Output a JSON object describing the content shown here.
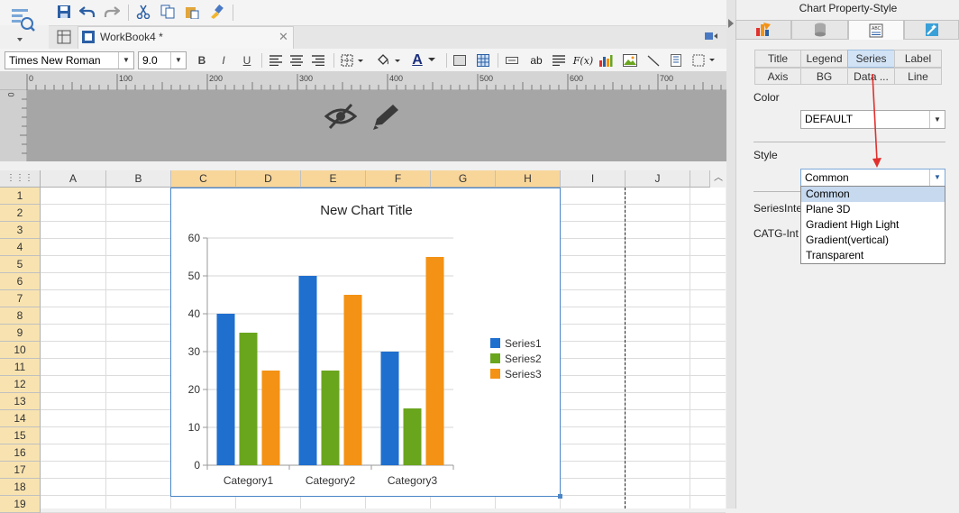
{
  "toolbar": {
    "workbook_tab": "WorkBook4 *",
    "font_name": "Times New Roman",
    "font_size": "9.0",
    "bold": "B",
    "italic": "I",
    "underline": "U",
    "text_color_icon": "A",
    "abc_icon": "ab",
    "fx_icon": "F(x)"
  },
  "ruler": {
    "ticks": [
      "0",
      "100",
      "200",
      "300",
      "400",
      "500",
      "600",
      "700"
    ],
    "left_mark": "0"
  },
  "sheet": {
    "columns": [
      "A",
      "B",
      "C",
      "D",
      "E",
      "F",
      "G",
      "H",
      "I",
      "J"
    ],
    "rows": [
      "1",
      "2",
      "3",
      "4",
      "5",
      "6",
      "7",
      "8",
      "9",
      "10",
      "11",
      "12",
      "13",
      "14",
      "15",
      "16",
      "17",
      "18",
      "19"
    ],
    "corner": "⋮⋮⋮"
  },
  "chart_data": {
    "type": "bar",
    "title": "New Chart Title",
    "categories": [
      "Category1",
      "Category2",
      "Category3"
    ],
    "series": [
      {
        "name": "Series1",
        "color": "#1f6fcf",
        "values": [
          40,
          50,
          30
        ]
      },
      {
        "name": "Series2",
        "color": "#6aa51e",
        "values": [
          35,
          25,
          15
        ]
      },
      {
        "name": "Series3",
        "color": "#f39214",
        "values": [
          25,
          45,
          55
        ]
      }
    ],
    "ylim": [
      0,
      60
    ],
    "yticks": [
      "0",
      "10",
      "20",
      "30",
      "40",
      "50",
      "60"
    ],
    "grid": true,
    "legend_position": "right"
  },
  "panel": {
    "title": "Chart Property-Style",
    "subtabs_row1": [
      "Title",
      "Legend",
      "Series",
      "Label"
    ],
    "subtabs_row2": [
      "Axis",
      "BG",
      "Data ...",
      "Line"
    ],
    "color_label": "Color",
    "color_value": "DEFAULT",
    "style_label": "Style",
    "style_value": "Common",
    "style_options": [
      "Common",
      "Plane 3D",
      "Gradient High Light",
      "Gradient(vertical)",
      "Transparent"
    ],
    "series_interval_label": "SeriesInte",
    "catg_interval_label": "CATG-Int",
    "arrow_color": "#e0312f"
  }
}
